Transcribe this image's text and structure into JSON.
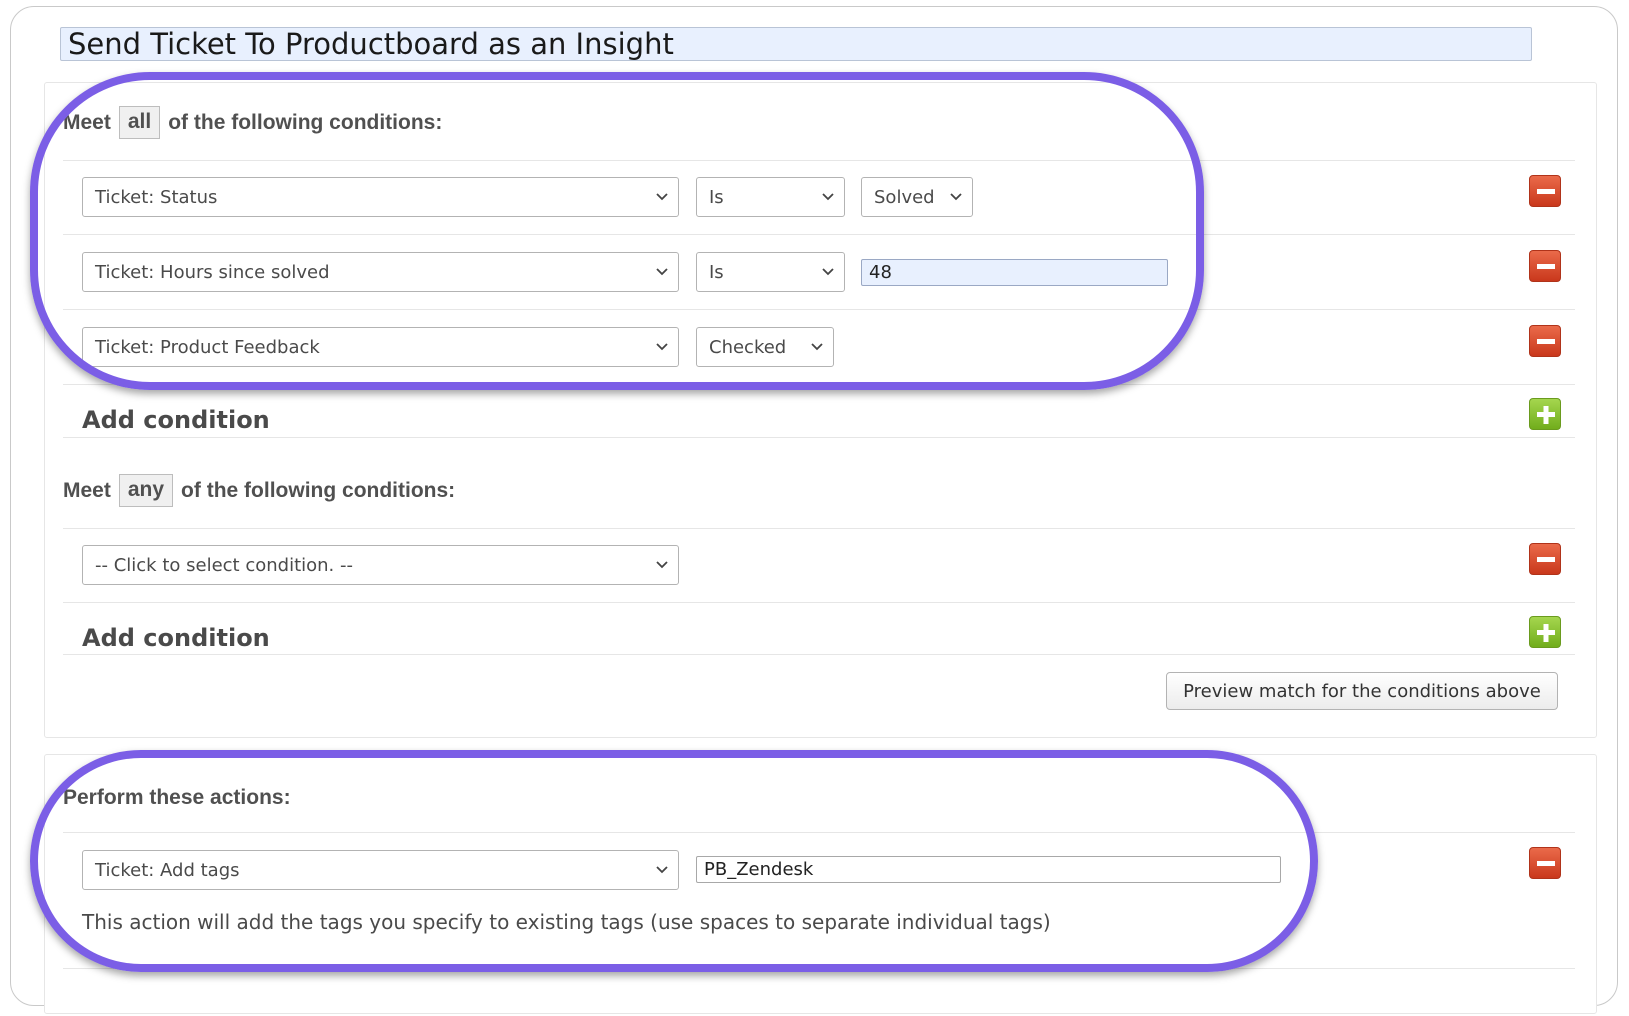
{
  "colors": {
    "highlight": "#7b5ee6",
    "remove_button": "#d9472b",
    "add_button": "#8dc43a",
    "title_bg": "#e8f0fe"
  },
  "title": "Send Ticket To Productboard as an Insight",
  "all_section": {
    "heading_prefix": "Meet",
    "mode": "all",
    "heading_suffix": "of the following conditions:",
    "conditions": [
      {
        "field": "Ticket: Status",
        "operator": "Is",
        "value": "Solved"
      },
      {
        "field": "Ticket: Hours since solved",
        "operator": "Is",
        "value": "48"
      },
      {
        "field": "Ticket: Product Feedback",
        "operator": "Checked"
      }
    ],
    "add_label": "Add condition"
  },
  "any_section": {
    "heading_prefix": "Meet",
    "mode": "any",
    "heading_suffix": "of the following conditions:",
    "conditions": [
      {
        "field": "-- Click to select condition. --"
      }
    ],
    "add_label": "Add condition"
  },
  "preview_button": "Preview match for the conditions above",
  "actions": {
    "heading": "Perform these actions:",
    "items": [
      {
        "action": "Ticket: Add tags",
        "value": "PB_Zendesk",
        "help": "This action will add the tags you specify to existing tags (use spaces to separate individual tags)"
      }
    ]
  },
  "icons": {
    "remove": "minus-icon",
    "add": "plus-icon",
    "dropdown": "chevron-down-icon"
  }
}
